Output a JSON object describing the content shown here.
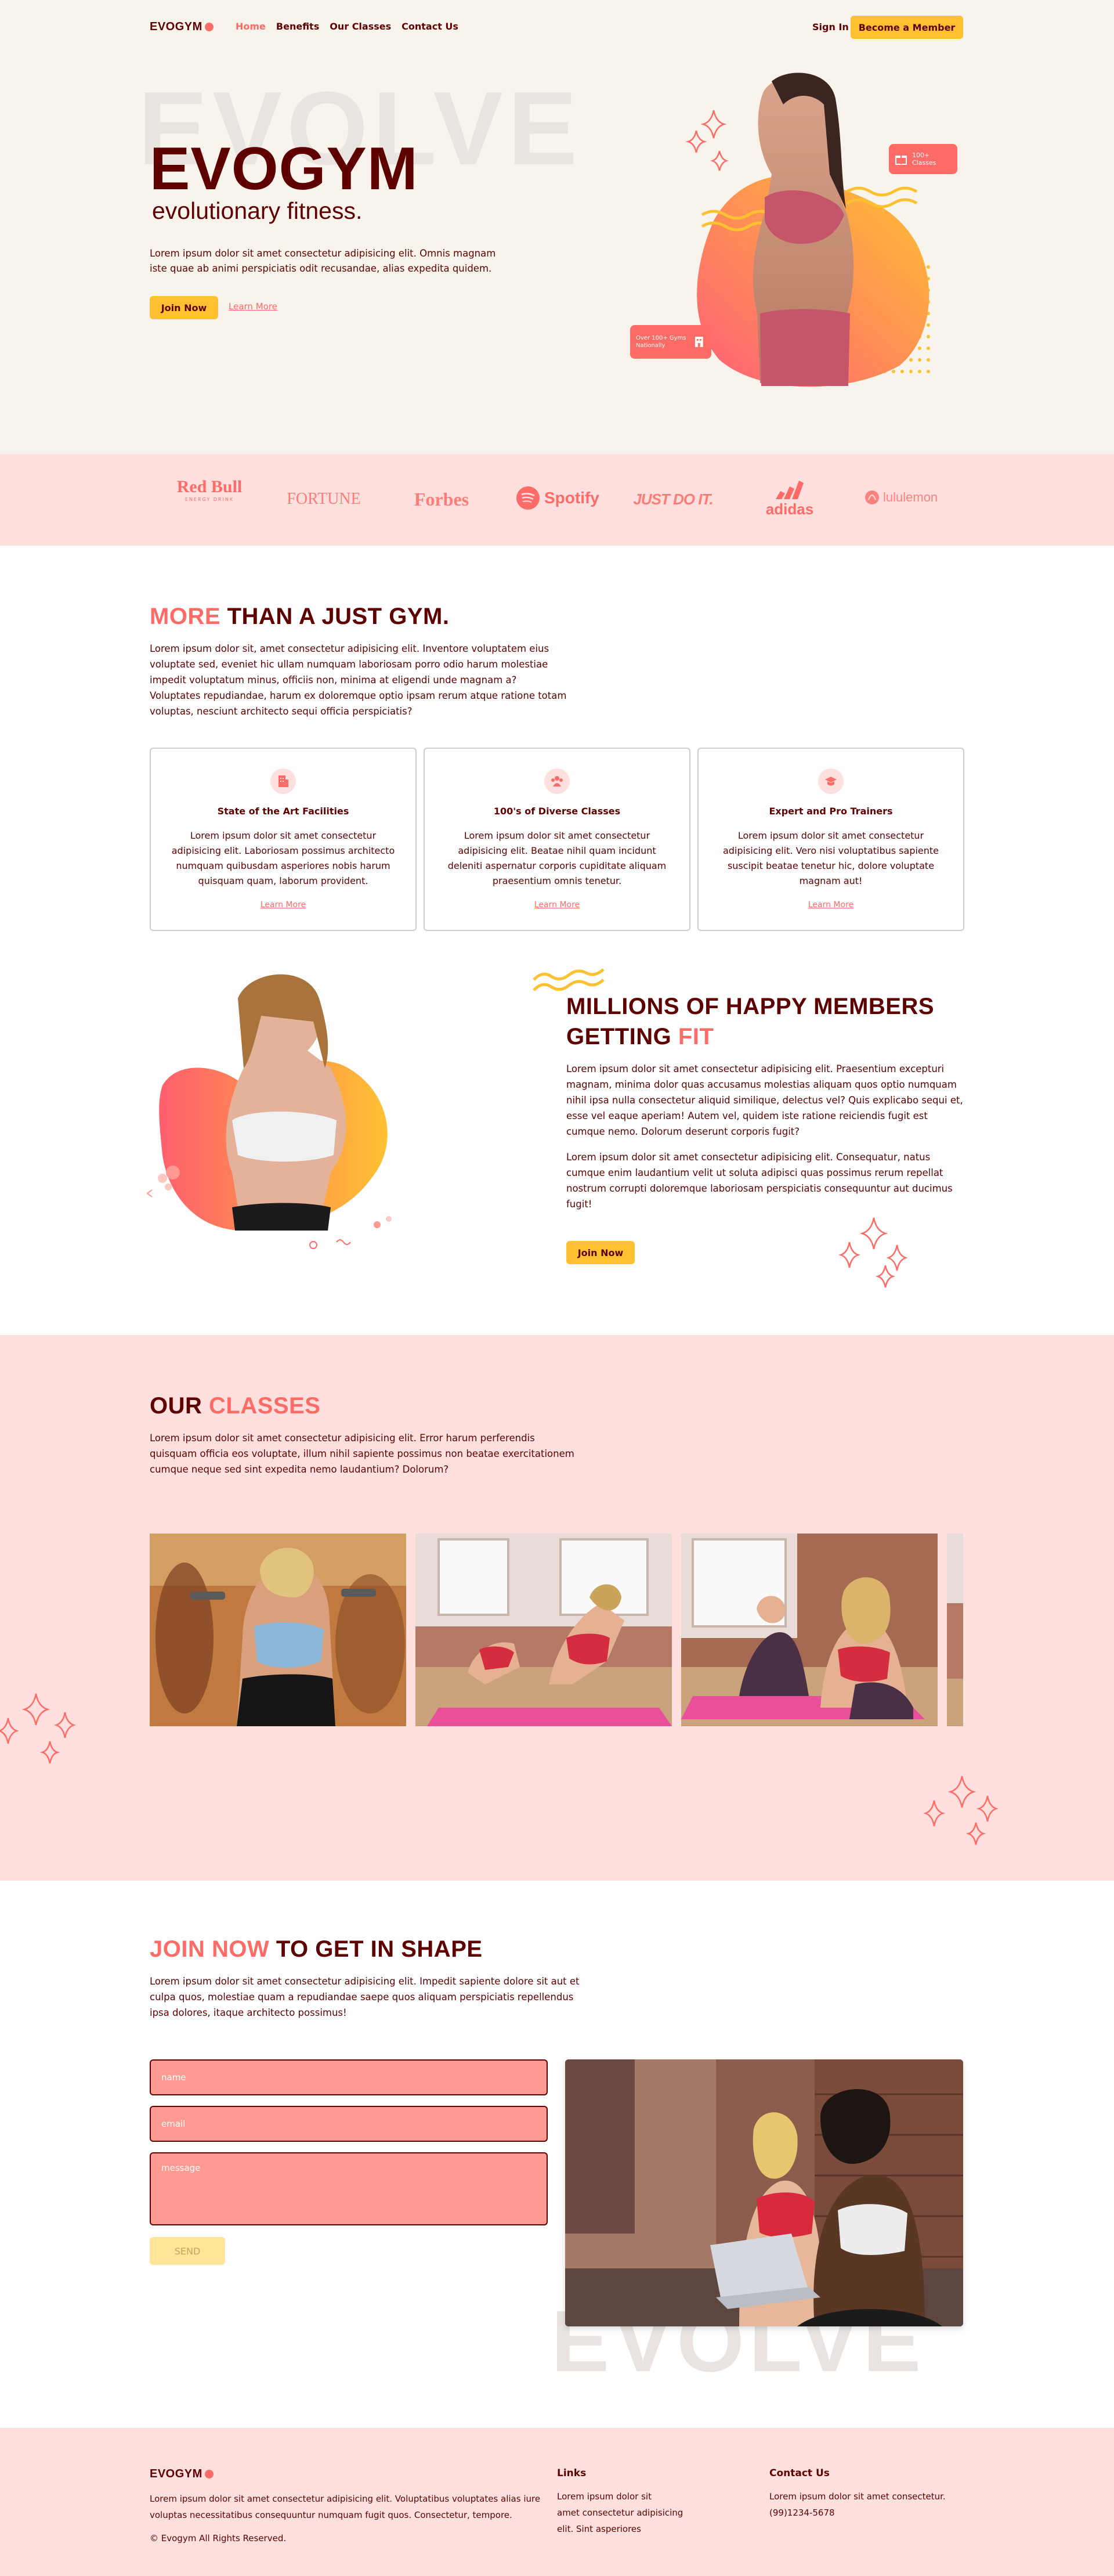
{
  "nav": {
    "logo": "EVOGYM",
    "links": [
      "Home",
      "Benefits",
      "Our Classes",
      "Contact Us"
    ],
    "sign_in": "Sign In",
    "cta": "Become a Member"
  },
  "hero": {
    "bg_word": "EVOLVE",
    "title": "EVOGYM",
    "subtitle": "evolutionary fitness.",
    "text": "Lorem ipsum dolor sit amet consectetur adipisicing elit. Omnis magnam iste quae ab animi perspiciatis odit recusandae, alias expedita quidem.",
    "join": "Join Now",
    "learn": "Learn More",
    "badge_classes": "100+ Classes",
    "badge_gyms": "Over 100+ Gyms Nationally"
  },
  "sponsors": [
    "Red Bull",
    "FORTUNE",
    "Forbes",
    "Spotify",
    "JUST DO IT.",
    "adidas",
    "lululemon"
  ],
  "sponsor_sub": "ENERGY DRINK",
  "benefits": {
    "title_accent": "MORE",
    "title_rest": " THAN A JUST GYM.",
    "text": "Lorem ipsum dolor sit, amet consectetur adipisicing elit. Inventore voluptatem eius voluptate sed, eveniet hic ullam numquam laboriosam porro odio harum molestiae impedit voluptatum minus, officiis non, minima at eligendi unde magnam a? Voluptates repudiandae, harum ex doloremque optio ipsam rerum atque ratione totam voluptas, nesciunt architecto sequi officia perspiciatis?",
    "cards": [
      {
        "title": "State of the Art Facilities",
        "text": "Lorem ipsum dolor sit amet consectetur adipisicing elit. Laboriosam possimus architecto numquam quibusdam asperiores nobis harum quisquam quam, laborum provident.",
        "link": "Learn More"
      },
      {
        "title": "100's of Diverse Classes",
        "text": "Lorem ipsum dolor sit amet consectetur adipisicing elit. Beatae nihil quam incidunt deleniti aspernatur corporis cupiditate aliquam praesentium omnis tenetur.",
        "link": "Learn More"
      },
      {
        "title": "Expert and Pro Trainers",
        "text": "Lorem ipsum dolor sit amet consectetur adipisicing elit. Vero nisi voluptatibus sapiente suscipit beatae tenetur hic, dolore voluptate magnam aut!",
        "link": "Learn More"
      }
    ]
  },
  "members": {
    "title_line1": "MILLIONS OF HAPPY MEMBERS",
    "title_line2": "GETTING ",
    "title_accent": "FIT",
    "para1": "Lorem ipsum dolor sit amet consectetur adipisicing elit. Praesentium excepturi magnam, minima dolor quas accusamus molestias aliquam quos optio numquam nihil ipsa nulla consectetur aliquid similique, delectus vel? Quis explicabo sequi et, esse vel eaque aperiam! Autem vel, quidem iste ratione reiciendis fugit est cumque nemo. Dolorum deserunt corporis fugit?",
    "para2": "Lorem ipsum dolor sit amet consectetur adipisicing elit. Consequatur, natus cumque enim laudantium velit ut soluta adipisci quas possimus rerum repellat nostrum corrupti doloremque laboriosam perspiciatis consequuntur aut ducimus fugit!",
    "join": "Join Now"
  },
  "classes": {
    "title": "OUR ",
    "title_accent": "CLASSES",
    "text": "Lorem ipsum dolor sit amet consectetur adipisicing elit. Error harum perferendis quisquam officia eos voluptate, illum nihil sapiente possimus non beatae exercitationem cumque neque sed sint expedita nemo laudantium? Dolorum?"
  },
  "contact": {
    "title_accent": "JOIN NOW",
    "title_rest": " TO GET IN SHAPE",
    "text": "Lorem ipsum dolor sit amet consectetur adipisicing elit. Impedit sapiente dolore sit aut et culpa quos, molestiae quam a repudiandae saepe quos aliquam perspiciatis repellendus ipsa dolores, itaque architecto possimus!",
    "name_ph": "name",
    "email_ph": "email",
    "message_ph": "message",
    "send": "SEND",
    "bg_word": "EVOLVE"
  },
  "footer": {
    "logo": "EVOGYM",
    "text": "Lorem ipsum dolor sit amet consectetur adipisicing elit. Voluptatibus voluptates alias iure voluptas necessitatibus consequuntur numquam fugit quos. Consectetur, tempore.",
    "copyright": "© Evogym All Rights Reserved.",
    "links_title": "Links",
    "links": [
      "Lorem ipsum dolor sit",
      "amet consectetur adipisicing",
      "elit. Sint asperiores"
    ],
    "contact_title": "Contact Us",
    "contact_text": "Lorem ipsum dolor sit amet consectetur.",
    "phone": "(99)1234-5678"
  },
  "colors": {
    "primary": "#5e0000",
    "accent": "#ff6b66",
    "yellow": "#ffc132",
    "pink_bg": "#ffe0de",
    "cream": "#f8f4eb"
  }
}
